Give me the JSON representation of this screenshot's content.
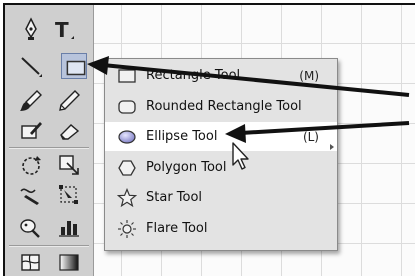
{
  "flyout": {
    "items": [
      {
        "label": "Rectangle Tool",
        "shortcut": "(M)",
        "icon": "rectangle-icon"
      },
      {
        "label": "Rounded Rectangle Tool",
        "shortcut": "",
        "icon": "rounded-rectangle-icon"
      },
      {
        "label": "Ellipse Tool",
        "shortcut": "(L)",
        "icon": "ellipse-icon"
      },
      {
        "label": "Polygon Tool",
        "shortcut": "",
        "icon": "polygon-icon"
      },
      {
        "label": "Star Tool",
        "shortcut": "",
        "icon": "star-icon"
      },
      {
        "label": "Flare Tool",
        "shortcut": "",
        "icon": "flare-icon"
      }
    ],
    "highlighted": "Ellipse Tool"
  },
  "toolbox": {
    "tools": [
      "pen-tool-icon",
      "type-tool-icon",
      "line-segment-tool-icon",
      "rectangle-tool-icon",
      "paintbrush-tool-icon",
      "pencil-tool-icon",
      "blob-brush-tool-icon",
      "eraser-tool-icon",
      "rotate-tool-icon",
      "scale-tool-icon",
      "warp-tool-icon",
      "free-transform-tool-icon",
      "symbol-sprayer-tool-icon",
      "graph-tool-icon",
      "mesh-tool-icon",
      "gradient-tool-icon"
    ],
    "type_tool_letter": "T"
  },
  "colors": {
    "arrow": "#111111",
    "highlight": "#ffffff",
    "menu_bg": "#e3e3e3"
  }
}
